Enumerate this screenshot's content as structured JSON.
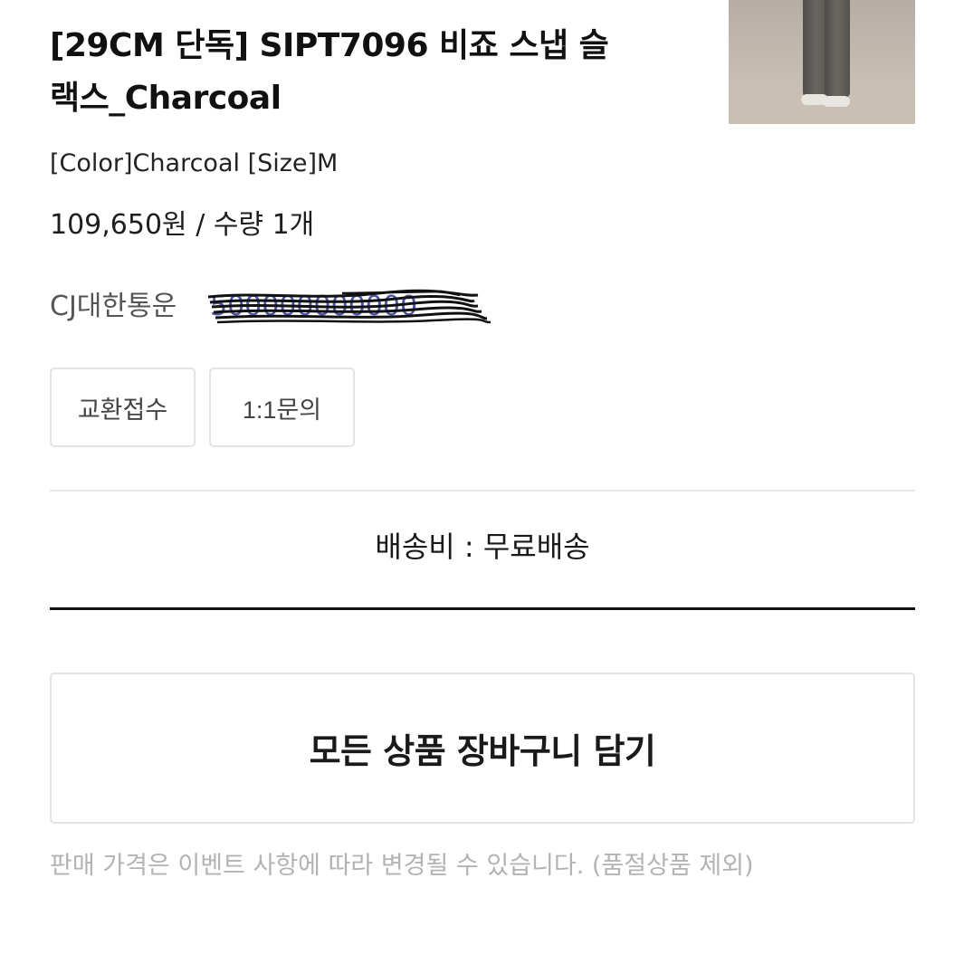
{
  "product": {
    "title_line1": "[29CM 단독] SIPT7096 비죠 스냅 슬",
    "title_line2": "랙스_Charcoal",
    "option": "[Color]Charcoal [Size]M",
    "price_quantity": "109,650원 / 수량 1개",
    "thumbnail_icon": "product-photo"
  },
  "delivery": {
    "courier": "CJ대한통운",
    "tracking_number": "500000000000"
  },
  "actions": {
    "exchange_label": "교환접수",
    "inquiry_label": "1:1문의",
    "add_all_to_cart_label": "모든 상품 장바구니 담기"
  },
  "shipping": {
    "fee_text": "배송비 : 무료배송"
  },
  "notice": {
    "text": "판매 가격은 이벤트 사항에 따라 변경될 수 있습니다. (품절상품 제외)"
  },
  "colors": {
    "tracking_link": "#4a57a8",
    "divider_dark": "#111111",
    "notice_text": "#b3b3b3"
  }
}
